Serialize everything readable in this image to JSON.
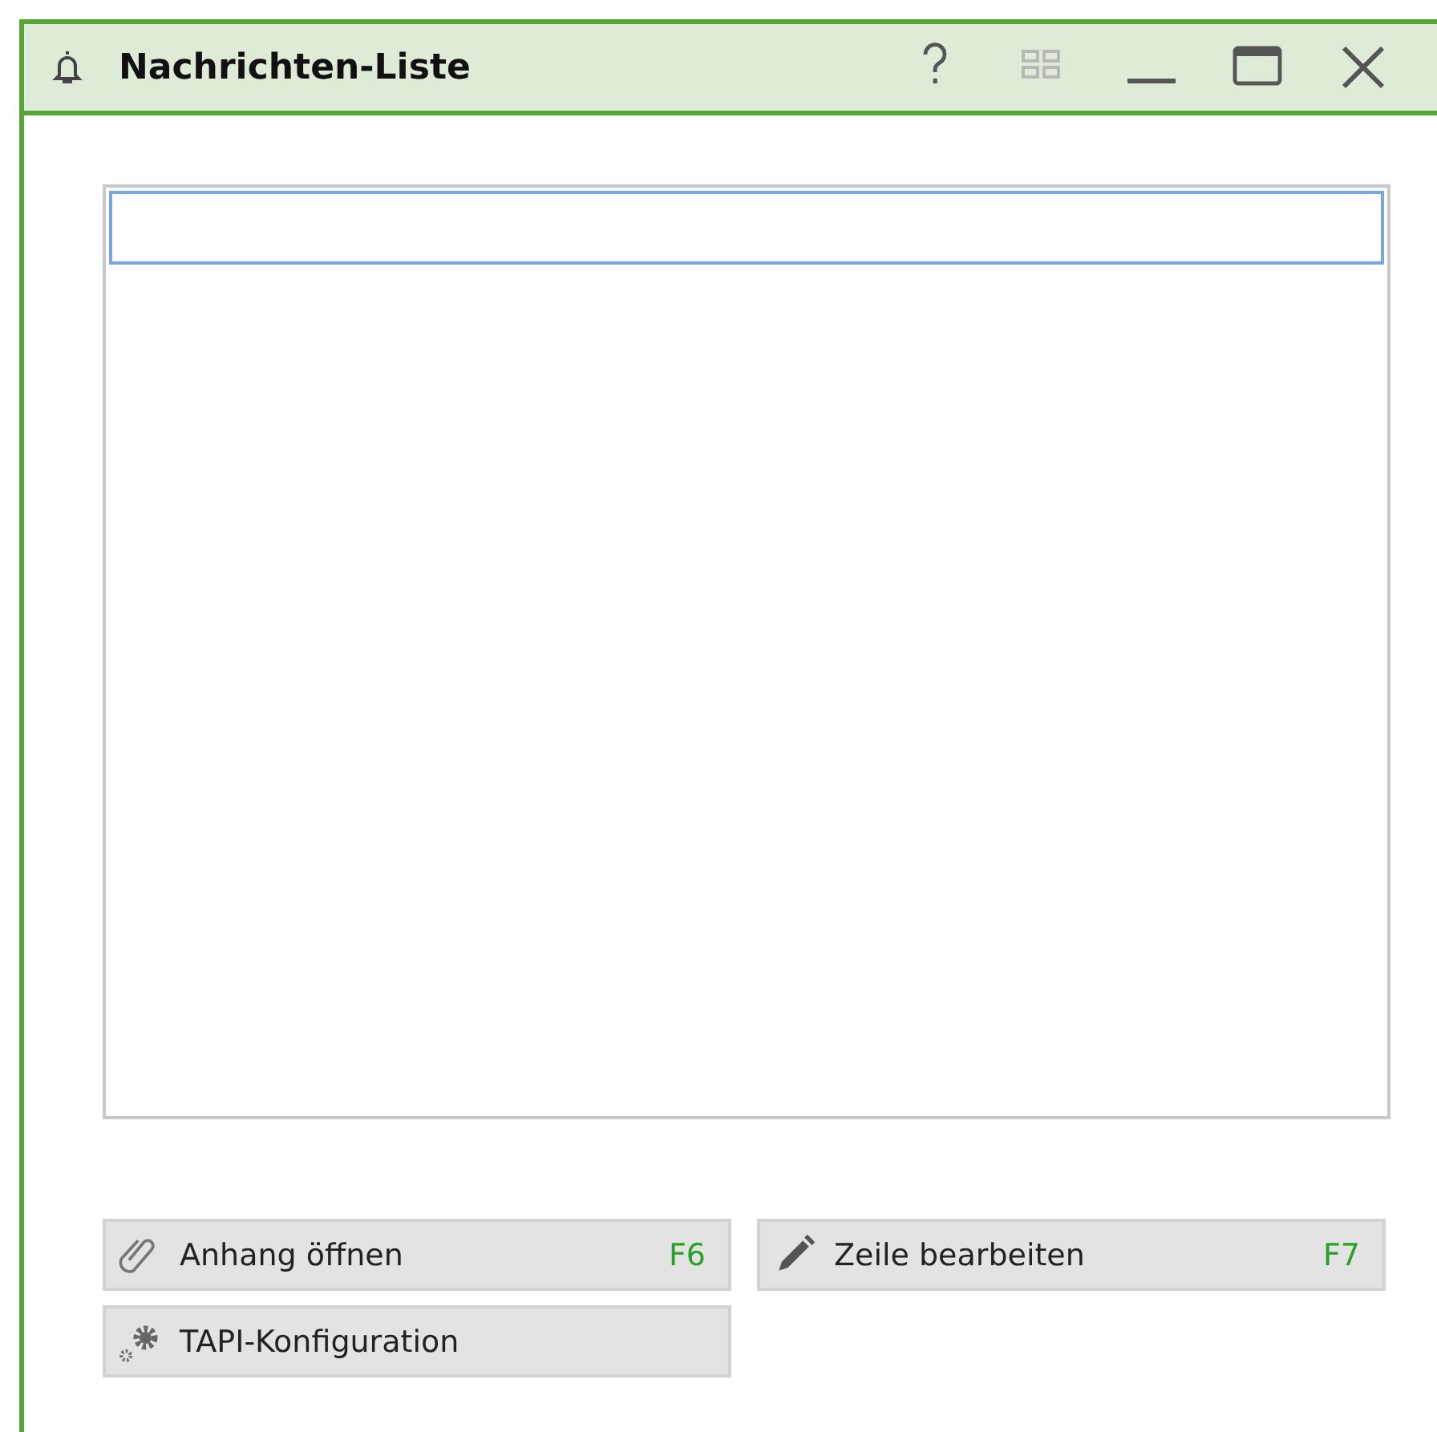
{
  "window": {
    "title": "Nachrichten-Liste",
    "controls": [
      {
        "kind": "help",
        "disabled": false
      },
      {
        "kind": "layout",
        "disabled": true
      },
      {
        "kind": "minimize",
        "disabled": false
      },
      {
        "kind": "maximize",
        "disabled": false
      },
      {
        "kind": "close",
        "disabled": false
      }
    ]
  },
  "list": {
    "rows": [
      {
        "focused": true
      }
    ]
  },
  "buttons": [
    {
      "kind": "attach",
      "label": "Anhang öffnen",
      "shortcut": "F6"
    },
    {
      "kind": "edit",
      "label": "Zeile bearbeiten",
      "shortcut": "F7"
    },
    {
      "kind": "config",
      "label": "TAPI-Konfiguration"
    }
  ]
}
